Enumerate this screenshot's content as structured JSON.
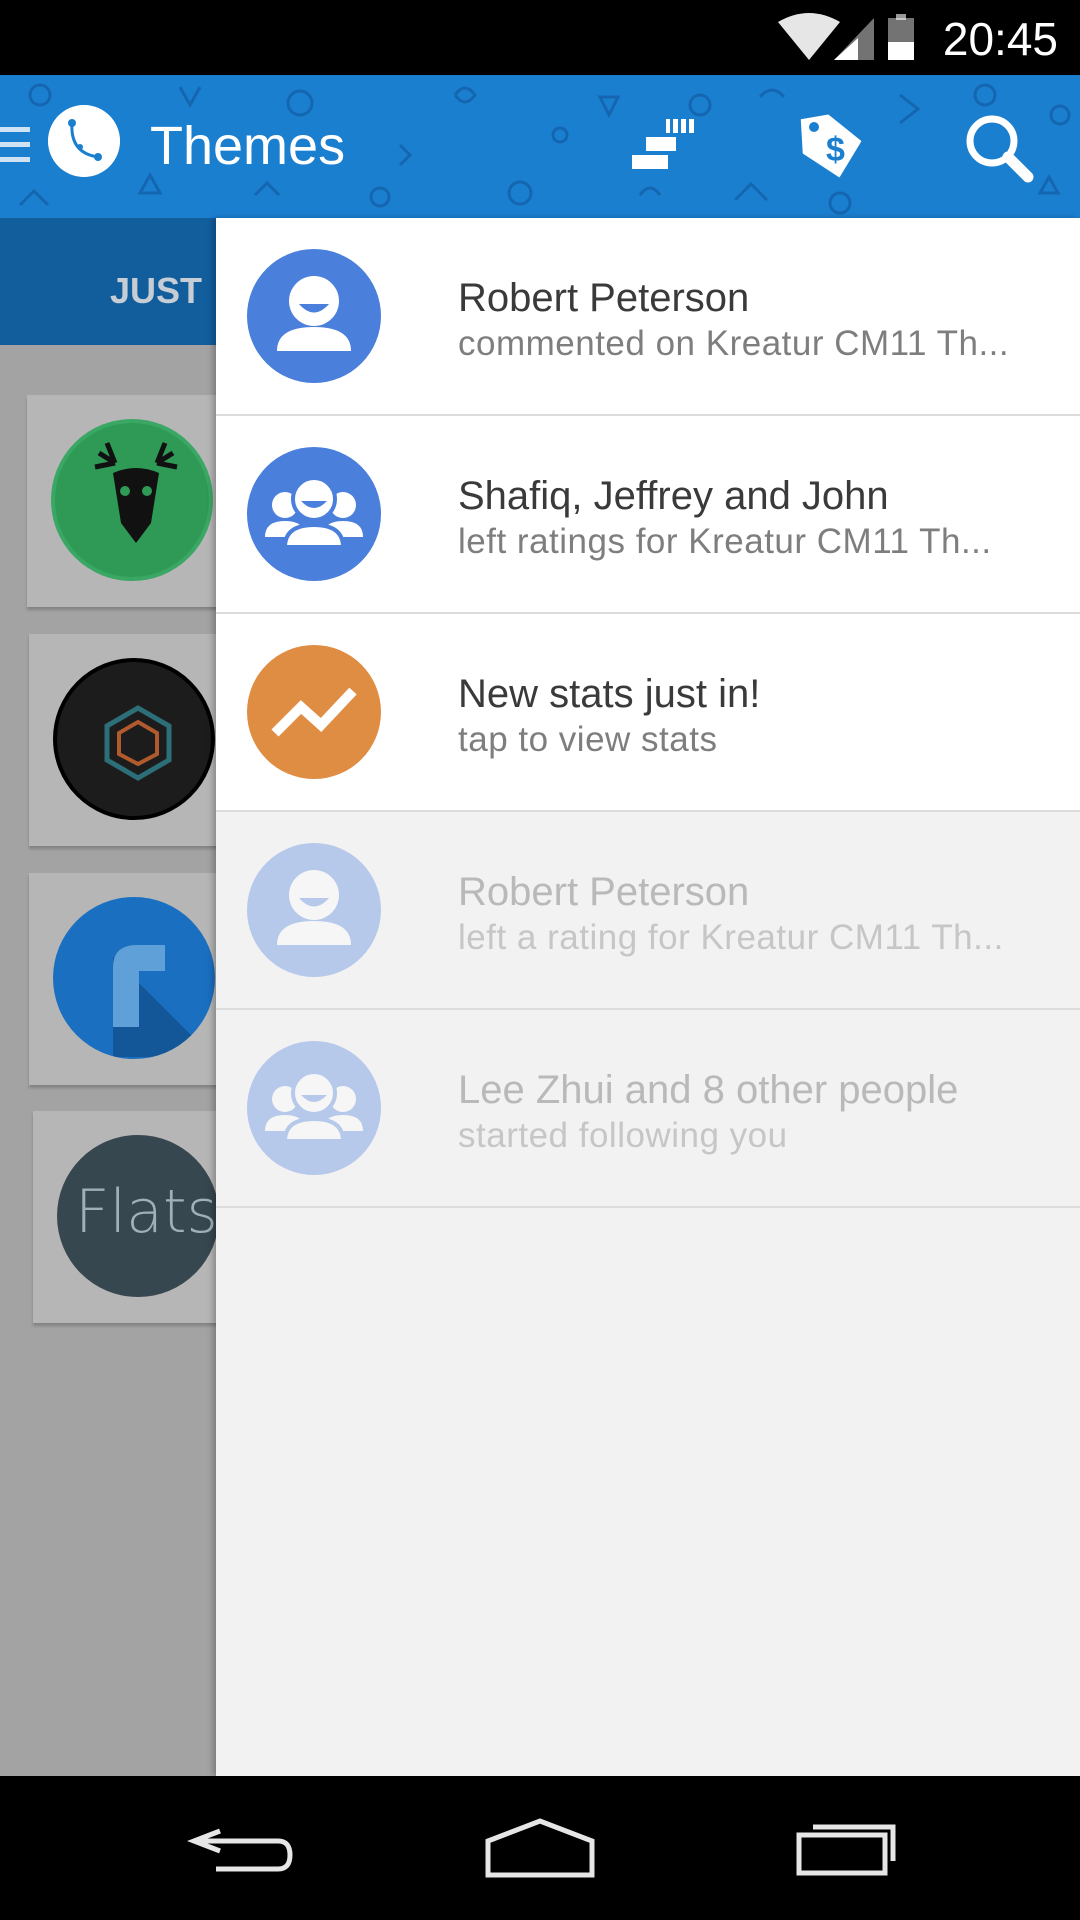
{
  "status_bar": {
    "time": "20:45",
    "icons": [
      "wifi-icon",
      "cell-signal-icon",
      "battery-icon"
    ]
  },
  "action_bar": {
    "title": "Themes",
    "color": "#1b7fd0",
    "icons": [
      "menu-icon",
      "app-logo-icon",
      "stats-icon",
      "price-tag-icon",
      "search-icon"
    ]
  },
  "background": {
    "tab_label": "JUST",
    "cards": [
      {
        "name": "deer-skull-theme-icon",
        "color": "#2e9a55"
      },
      {
        "name": "hexagon-theme-icon",
        "color": "#1c1c1c"
      },
      {
        "name": "r-theme-icon",
        "color": "#1a6fc0"
      },
      {
        "name": "flats-theme-icon",
        "color": "#37474f",
        "text": "Flats"
      }
    ]
  },
  "notifications": [
    {
      "title": "Robert Peterson",
      "subtitle": "commented on Kreatur CM11 Th...",
      "icon": "user-icon",
      "color": "#4a7fdc",
      "unread": true
    },
    {
      "title": "Shafiq, Jeffrey and John",
      "subtitle": "left ratings for  Kreatur CM11 Th...",
      "icon": "group-icon",
      "color": "#4a7fdc",
      "unread": true
    },
    {
      "title": "New stats just in!",
      "subtitle": "tap to view stats",
      "icon": "trending-up-icon",
      "color": "#e08d44",
      "unread": true
    },
    {
      "title": "Robert Peterson",
      "subtitle": "left a rating for Kreatur CM11 Th...",
      "icon": "user-icon",
      "color": "#4a7fdc",
      "unread": false
    },
    {
      "title": "Lee Zhui and 8 other people",
      "subtitle": "started following you",
      "icon": "group-icon",
      "color": "#4a7fdc",
      "unread": false
    }
  ],
  "nav_bar": {
    "icons": [
      "back-icon",
      "home-icon",
      "recents-icon"
    ]
  }
}
